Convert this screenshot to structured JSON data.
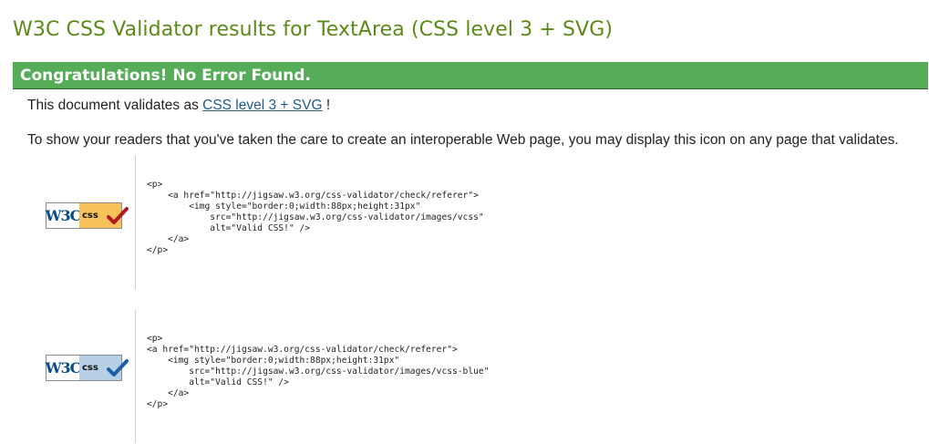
{
  "page": {
    "title": "W3C CSS Validator results for TextArea (CSS level 3 + SVG)"
  },
  "banner": {
    "text": "Congratulations! No Error Found."
  },
  "validates": {
    "prefix": "This document validates as ",
    "link_text": "CSS level 3 + SVG",
    "suffix": " !"
  },
  "icon_note": "To show your readers that you've taken the care to create an interoperable Web page, you may display this icon on any page that validates.",
  "badges": [
    {
      "w3c_text": "W3C",
      "css_text": "css",
      "badge_color": "#f7c25a",
      "check_color": "#b3191e",
      "icon": "w3c-css-valid-icon",
      "code": "<p>\n    <a href=\"http://jigsaw.w3.org/css-validator/check/referer\">\n        <img style=\"border:0;width:88px;height:31px\"\n            src=\"http://jigsaw.w3.org/css-validator/images/vcss\"\n            alt=\"Valid CSS!\" />\n    </a>\n</p>"
    },
    {
      "w3c_text": "W3C",
      "css_text": "css",
      "badge_color": "#b6cfe6",
      "check_color": "#1f5fa8",
      "icon": "w3c-css-valid-blue-icon",
      "code": "<p>\n<a href=\"http://jigsaw.w3.org/css-validator/check/referer\">\n    <img style=\"border:0;width:88px;height:31px\"\n        src=\"http://jigsaw.w3.org/css-validator/images/vcss-blue\"\n        alt=\"Valid CSS!\" />\n    </a>\n</p>"
    }
  ]
}
